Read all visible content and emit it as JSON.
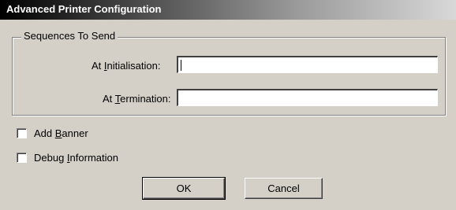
{
  "window": {
    "title": "Advanced Printer Configuration"
  },
  "sequences_group": {
    "legend": "Sequences To Send",
    "init_label_pre": "At ",
    "init_label_ul": "I",
    "init_label_post": "nitialisation:",
    "init_value": "",
    "term_label_pre": "At ",
    "term_label_ul": "T",
    "term_label_post": "ermination:",
    "term_value": ""
  },
  "options": {
    "add_banner_pre": "Add ",
    "add_banner_ul": "B",
    "add_banner_post": "anner",
    "add_banner_checked": false,
    "debug_pre": "Debug ",
    "debug_ul": "I",
    "debug_post": "nformation",
    "debug_checked": false
  },
  "buttons": {
    "ok_label": "OK",
    "cancel_label": "Cancel"
  }
}
